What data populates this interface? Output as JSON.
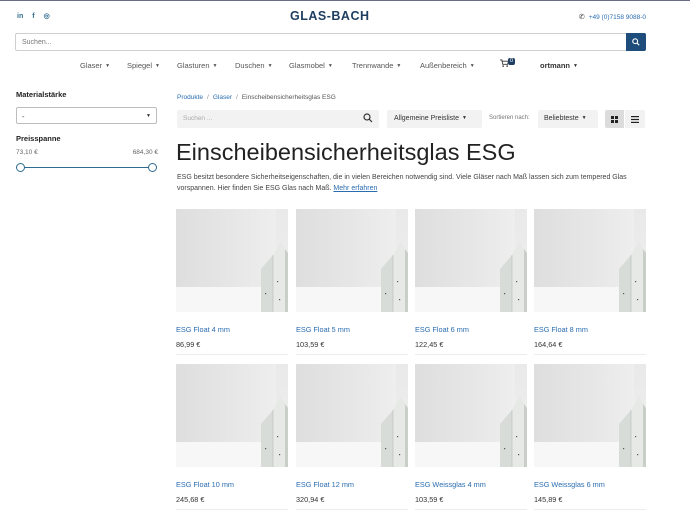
{
  "header": {
    "social": [
      {
        "icon": "linkedin-icon",
        "glyph": "in"
      },
      {
        "icon": "facebook-icon",
        "glyph": "f"
      },
      {
        "icon": "instagram-icon",
        "glyph": "◎"
      }
    ],
    "logo": "GLAS-BACH",
    "phone": "+49 (0)7158 9088-0"
  },
  "search": {
    "placeholder": "Suchen..."
  },
  "nav": {
    "items": [
      {
        "label": "Glaser"
      },
      {
        "label": "Spiegel"
      },
      {
        "label": "Glasturen"
      },
      {
        "label": "Duschen"
      },
      {
        "label": "Glasmobel"
      },
      {
        "label": "Trennwande"
      },
      {
        "label": "Außenbereich"
      }
    ],
    "cart_count": "0",
    "user": "ortmann"
  },
  "sidebar": {
    "material_heading": "Materialstärke",
    "material_value": "-",
    "price_heading": "Preisspanne",
    "price_min": "73,10 €",
    "price_max": "684,30 €",
    "range_low": 0,
    "range_high": 1
  },
  "breadcrumb": {
    "items": [
      "Produkte",
      "Glaser",
      "Einscheibensicherheitsglas ESG"
    ]
  },
  "filters": {
    "search_placeholder": "Suchen ...",
    "pricelist": "Allgemeine Preisliste",
    "sort_label": "Sortieren nach:",
    "sort_value": "Beliebteste"
  },
  "page": {
    "title": "Einscheibensicherheitsglas ESG",
    "description": "ESG besitzt besondere Sicherheitseigenschaften, die in vielen Bereichen notwendig sind. Viele Gläser nach Maß lassen sich zum tempered Glas vorspannen. Hier finden Sie ESG Glas nach Maß.",
    "more_link": "Mehr erfahren"
  },
  "products": [
    {
      "name": "ESG Float 4 mm",
      "price": "86,99 €"
    },
    {
      "name": "ESG Float 5 mm",
      "price": "103,59 €"
    },
    {
      "name": "ESG Float 6 mm",
      "price": "122,45 €"
    },
    {
      "name": "ESG Float 8 mm",
      "price": "164,64 €"
    },
    {
      "name": "ESG Float 10 mm",
      "price": "245,68 €"
    },
    {
      "name": "ESG Float 12 mm",
      "price": "320,94 €"
    },
    {
      "name": "ESG Weissglas 4 mm",
      "price": "103,59 €"
    },
    {
      "name": "ESG Weissglas 6 mm",
      "price": "145,89 €"
    }
  ],
  "colors": {
    "brand": "#1f3f62",
    "link": "#2a6cb0",
    "button": "#1e4d7b"
  }
}
